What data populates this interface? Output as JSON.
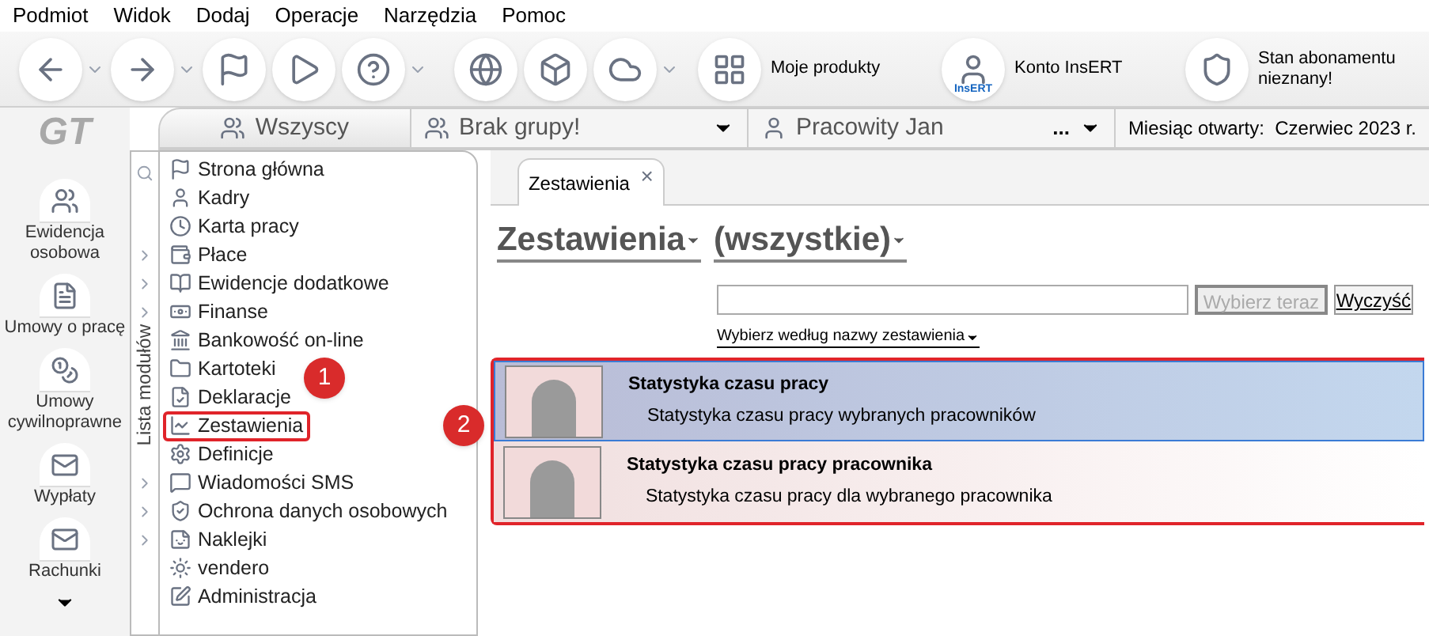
{
  "menu_bar": [
    "Podmiot",
    "Widok",
    "Dodaj",
    "Operacje",
    "Narzędzia",
    "Pomoc"
  ],
  "toolbar": [
    {
      "kind": "icon",
      "dropdown": true
    },
    {
      "kind": "icon",
      "dropdown": true
    },
    {
      "kind": "icon",
      "dropdown": false
    },
    {
      "kind": "icon",
      "dropdown": false
    },
    {
      "kind": "icon",
      "dropdown": true
    },
    {
      "kind": "icon",
      "dropdown": false
    },
    {
      "kind": "icon",
      "dropdown": false
    },
    {
      "kind": "icon",
      "dropdown": true
    },
    {
      "kind": "labeled",
      "label": "Moje produkty"
    },
    {
      "kind": "labeled",
      "badge": "InsERT",
      "label": "Konto InsERT"
    },
    {
      "kind": "labeled",
      "label": "Stan abonamentu nieznany!"
    }
  ],
  "logo": "GT",
  "context_bar": {
    "group_all": "Wszyscy",
    "group": "Brak grupy!",
    "employee": "Pracowity Jan",
    "more": "...",
    "month": "Miesiąc otwarty:  Czerwiec 2023 r."
  },
  "sidebar": {
    "items": [
      "Ewidencja osobowa",
      "Umowy o pracę",
      "Umowy cywilnoprawne",
      "Wypłaty",
      "Rachunki"
    ]
  },
  "module_list": {
    "title": "Lista modułów",
    "items": [
      {
        "label": "Strona główna",
        "submenu": false,
        "highlighted": false
      },
      {
        "label": "Kadry",
        "submenu": false,
        "highlighted": false
      },
      {
        "label": "Karta pracy",
        "submenu": false,
        "highlighted": false
      },
      {
        "label": "Płace",
        "submenu": true,
        "highlighted": false
      },
      {
        "label": "Ewidencje dodatkowe",
        "submenu": true,
        "highlighted": false
      },
      {
        "label": "Finanse",
        "submenu": true,
        "highlighted": false
      },
      {
        "label": "Bankowość on-line",
        "submenu": false,
        "highlighted": false
      },
      {
        "label": "Kartoteki",
        "submenu": false,
        "highlighted": false
      },
      {
        "label": "Deklaracje",
        "submenu": false,
        "highlighted": false
      },
      {
        "label": "Zestawienia",
        "submenu": false,
        "highlighted": true
      },
      {
        "label": "Definicje",
        "submenu": false,
        "highlighted": false
      },
      {
        "label": "Wiadomości SMS",
        "submenu": true,
        "highlighted": false
      },
      {
        "label": "Ochrona danych osobowych",
        "submenu": true,
        "highlighted": false
      },
      {
        "label": "Naklejki",
        "submenu": true,
        "highlighted": false
      },
      {
        "label": "vendero",
        "submenu": false,
        "highlighted": false
      },
      {
        "label": "Administracja",
        "submenu": false,
        "highlighted": false
      }
    ]
  },
  "content": {
    "tab": "Zestawienia",
    "close": "×",
    "heading": "Zestawienia",
    "filter": "(wszystkie)",
    "search": {
      "button": "Wybierz teraz",
      "button_disabled": true,
      "clear": "Wyczyść"
    },
    "sort_link": "Wybierz według nazwy zestawienia",
    "reports": [
      {
        "title": "Statystyka czasu pracy",
        "description": "Statystyka czasu pracy wybranych pracowników",
        "selected": true
      },
      {
        "title": "Statystyka czasu pracy pracownika",
        "description": "Statystyka czasu pracy dla wybranego pracownika",
        "selected": false
      }
    ]
  },
  "callouts": [
    "1",
    "2"
  ]
}
